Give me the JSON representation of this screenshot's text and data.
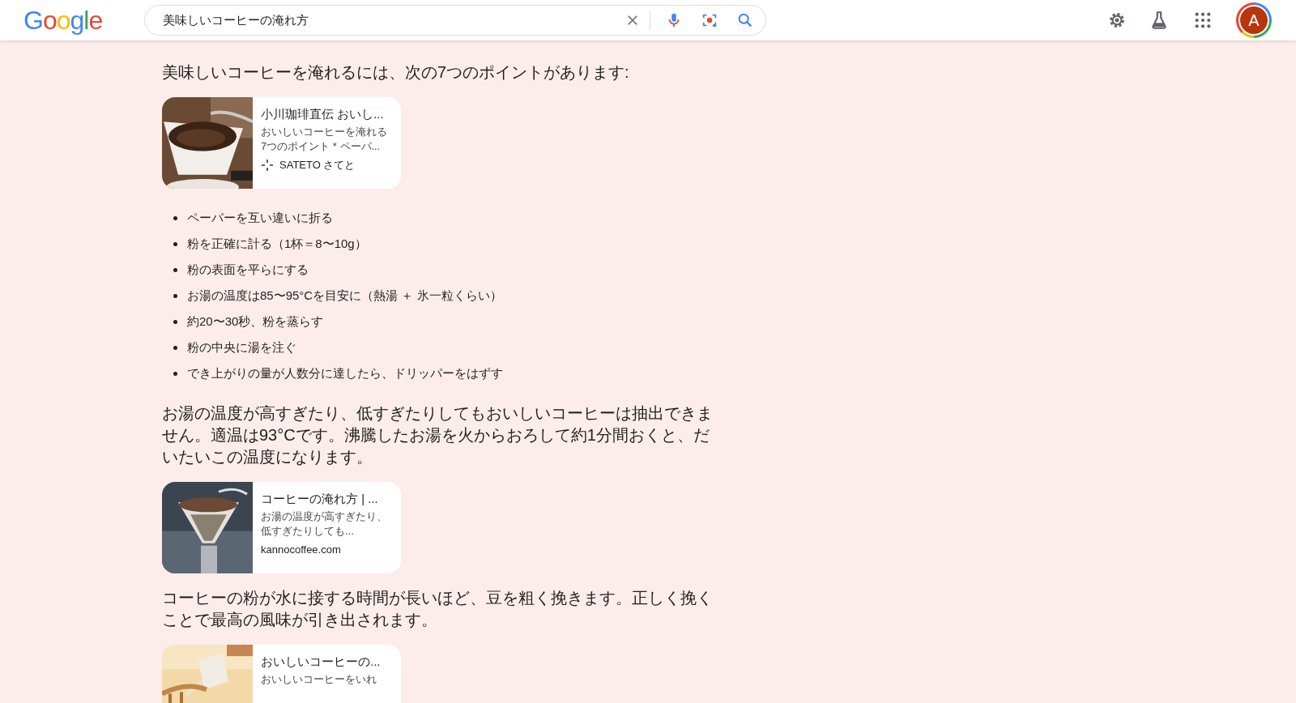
{
  "header": {
    "logo": "Google",
    "search": {
      "value": "美味しいコーヒーの淹れ方"
    },
    "avatar": "A"
  },
  "blocks": [
    {
      "kind": "text",
      "text": "美味しいコーヒーを淹れるには、次の7つのポイントがあります:"
    },
    {
      "kind": "card",
      "title": "小川珈琲直伝 おいし...",
      "snippet": "おいしいコーヒーを淹れる7つのポイント * ペーパ...",
      "source": "SATETO さてと",
      "source_icon": true
    },
    {
      "kind": "list",
      "items": [
        "ペーパーを互い違いに折る",
        "粉を正確に計る（1杯＝8〜10g）",
        "粉の表面を平らにする",
        "お湯の温度は85〜95°Cを目安に（熱湯 ＋ 氷一粒くらい）",
        "約20〜30秒、粉を蒸らす",
        "粉の中央に湯を注ぐ",
        "でき上がりの量が人数分に達したら、ドリッパーをはずす"
      ]
    },
    {
      "kind": "text",
      "text": "お湯の温度が高すぎたり、低すぎたりしてもおいしいコーヒーは抽出できません。適温は93°Cです。沸騰したお湯を火からおろして約1分間おくと、だいたいこの温度になります。"
    },
    {
      "kind": "card",
      "title": "コーヒーの淹れ方 | ...",
      "snippet": "お湯の温度が高すぎたり、低すぎたりしても...",
      "source": "kannocoffee.com",
      "source_icon": false
    },
    {
      "kind": "text",
      "text": "コーヒーの粉が水に接する時間が長いほど、豆を粗く挽きます。正しく挽くことで最高の風味が引き出されます。"
    },
    {
      "kind": "card",
      "title": "おいしいコーヒーの...",
      "snippet": "おいしいコーヒーをいれ"
    }
  ]
}
